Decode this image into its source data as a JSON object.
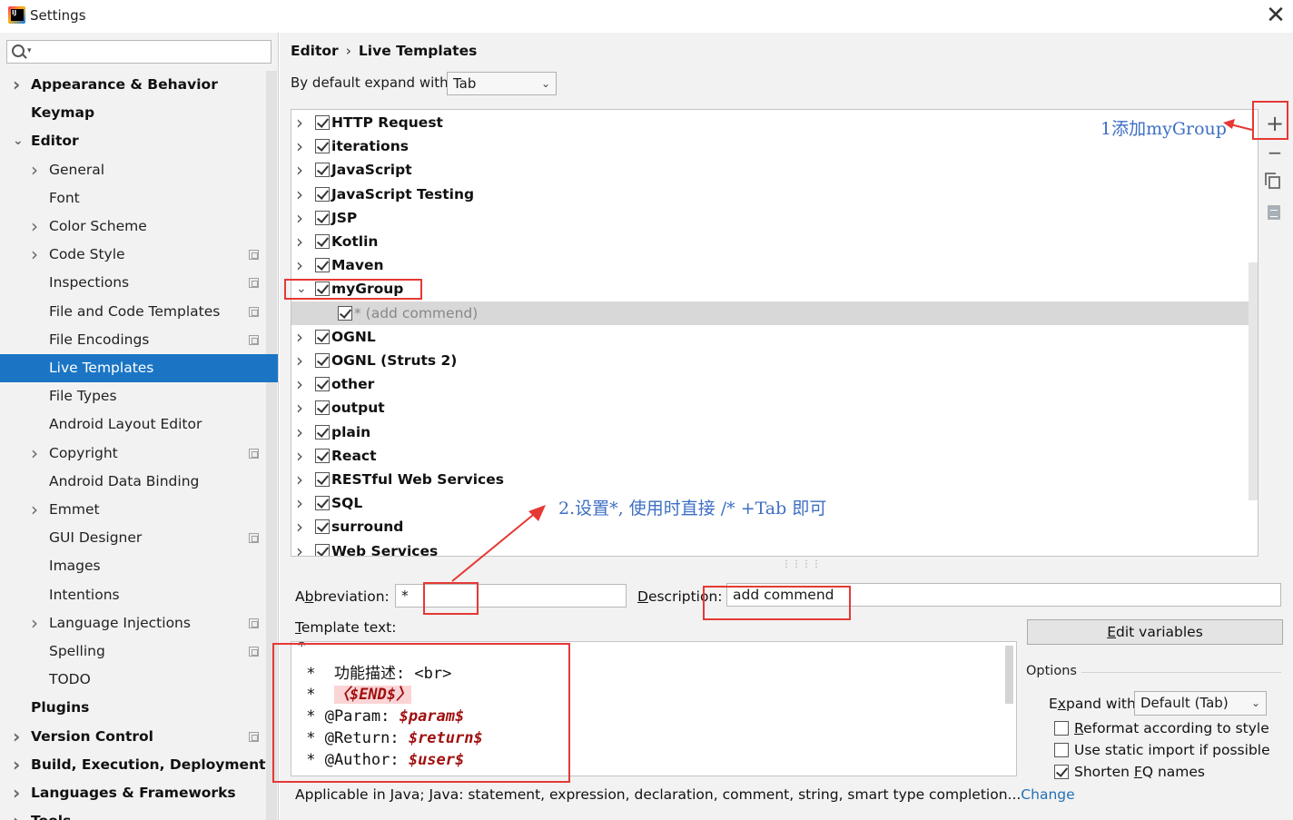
{
  "window": {
    "title": "Settings",
    "close_glyph": "✕"
  },
  "search": {
    "placeholder": ""
  },
  "sidebar": {
    "items": [
      {
        "label": "Appearance & Behavior",
        "bold": true,
        "chevron": "right",
        "badge": false
      },
      {
        "label": "Keymap",
        "bold": true,
        "chevron": "none",
        "badge": false
      },
      {
        "label": "Editor",
        "bold": true,
        "chevron": "down",
        "badge": false
      },
      {
        "label": "General",
        "bold": false,
        "chevron": "right",
        "badge": false
      },
      {
        "label": "Font",
        "bold": false,
        "chevron": "none",
        "badge": false
      },
      {
        "label": "Color Scheme",
        "bold": false,
        "chevron": "right",
        "badge": false
      },
      {
        "label": "Code Style",
        "bold": false,
        "chevron": "right",
        "badge": true
      },
      {
        "label": "Inspections",
        "bold": false,
        "chevron": "none",
        "badge": true
      },
      {
        "label": "File and Code Templates",
        "bold": false,
        "chevron": "none",
        "badge": true
      },
      {
        "label": "File Encodings",
        "bold": false,
        "chevron": "none",
        "badge": true
      },
      {
        "label": "Live Templates",
        "bold": false,
        "chevron": "none",
        "badge": false,
        "selected": true
      },
      {
        "label": "File Types",
        "bold": false,
        "chevron": "none",
        "badge": false
      },
      {
        "label": "Android Layout Editor",
        "bold": false,
        "chevron": "none",
        "badge": false
      },
      {
        "label": "Copyright",
        "bold": false,
        "chevron": "right",
        "badge": true
      },
      {
        "label": "Android Data Binding",
        "bold": false,
        "chevron": "none",
        "badge": false
      },
      {
        "label": "Emmet",
        "bold": false,
        "chevron": "right",
        "badge": false
      },
      {
        "label": "GUI Designer",
        "bold": false,
        "chevron": "none",
        "badge": true
      },
      {
        "label": "Images",
        "bold": false,
        "chevron": "none",
        "badge": false
      },
      {
        "label": "Intentions",
        "bold": false,
        "chevron": "none",
        "badge": false
      },
      {
        "label": "Language Injections",
        "bold": false,
        "chevron": "right",
        "badge": true
      },
      {
        "label": "Spelling",
        "bold": false,
        "chevron": "none",
        "badge": true
      },
      {
        "label": "TODO",
        "bold": false,
        "chevron": "none",
        "badge": false
      },
      {
        "label": "Plugins",
        "bold": true,
        "chevron": "none",
        "badge": false
      },
      {
        "label": "Version Control",
        "bold": true,
        "chevron": "right",
        "badge": true
      },
      {
        "label": "Build, Execution, Deployment",
        "bold": true,
        "chevron": "right",
        "badge": false
      },
      {
        "label": "Languages & Frameworks",
        "bold": true,
        "chevron": "right",
        "badge": false
      },
      {
        "label": "Tools",
        "bold": true,
        "chevron": "right",
        "badge": false
      }
    ]
  },
  "breadcrumb": {
    "parent": "Editor",
    "separator": "›",
    "current": "Live Templates"
  },
  "expand_default": {
    "label": "By default expand with",
    "value": "Tab"
  },
  "template_groups": [
    {
      "label": "HTTP Request",
      "checked": true,
      "expanded": false
    },
    {
      "label": "iterations",
      "checked": true,
      "expanded": false
    },
    {
      "label": "JavaScript",
      "checked": true,
      "expanded": false
    },
    {
      "label": "JavaScript Testing",
      "checked": true,
      "expanded": false
    },
    {
      "label": "JSP",
      "checked": true,
      "expanded": false
    },
    {
      "label": "Kotlin",
      "checked": true,
      "expanded": false
    },
    {
      "label": "Maven",
      "checked": true,
      "expanded": false
    },
    {
      "label": "myGroup",
      "checked": true,
      "expanded": true
    },
    {
      "label": "* (add commend)",
      "checked": true,
      "child": true
    },
    {
      "label": "OGNL",
      "checked": true,
      "expanded": false
    },
    {
      "label": "OGNL (Struts 2)",
      "checked": true,
      "expanded": false
    },
    {
      "label": "other",
      "checked": true,
      "expanded": false
    },
    {
      "label": "output",
      "checked": true,
      "expanded": false
    },
    {
      "label": "plain",
      "checked": true,
      "expanded": false
    },
    {
      "label": "React",
      "checked": true,
      "expanded": false
    },
    {
      "label": "RESTful Web Services",
      "checked": true,
      "expanded": false
    },
    {
      "label": "SQL",
      "checked": true,
      "expanded": false
    },
    {
      "label": "surround",
      "checked": true,
      "expanded": false
    },
    {
      "label": "Web Services",
      "checked": true,
      "expanded": false
    }
  ],
  "toolbar": {
    "add_glyph": "+",
    "remove_glyph": "−"
  },
  "form": {
    "abbreviation_pre": "A",
    "abbreviation_u": "b",
    "abbreviation_post": "breviation:",
    "abbreviation_value": "*",
    "description_u": "D",
    "description_post": "escription:",
    "description_value": "add commend",
    "template_text_u": "T",
    "template_text_post": "emplate text:"
  },
  "template_text": {
    "line1": "*",
    "line2": " *  功能描述: <br>",
    "line3_prefix": " *  ",
    "line3_end": "〈$END$〉",
    "line4_prefix": " * @Param: ",
    "line4_var": "$param$",
    "line5_prefix": " * @Return: ",
    "line5_var": "$return$",
    "line6_prefix": " * @Author: ",
    "line6_var": "$user$"
  },
  "edit_variables": {
    "u": "E",
    "post": "dit variables"
  },
  "options": {
    "title": "Options",
    "expand_pre": "E",
    "expand_u": "x",
    "expand_post": "pand with",
    "expand_value": "Default (Tab)",
    "reformat": {
      "u": "R",
      "post": "eformat according to style",
      "checked": false
    },
    "static_import": {
      "label": "Use static import if possible",
      "checked": false
    },
    "shorten": {
      "pre": "Shorten ",
      "u": "F",
      "post": "Q names",
      "checked": true
    }
  },
  "applicable": {
    "text": "Applicable in Java; Java: statement, expression, declaration, comment, string, smart type completion...",
    "link": "Change"
  },
  "annotations": {
    "step1": "1添加myGroup",
    "step2": "2.设置*, 使用时直接 /* +Tab 即可"
  },
  "colors": {
    "selection": "#1b75c4",
    "annotation": "#e53935",
    "annotation_text": "#3e6fc4",
    "variable": "#a01010",
    "link": "#2470b3"
  }
}
